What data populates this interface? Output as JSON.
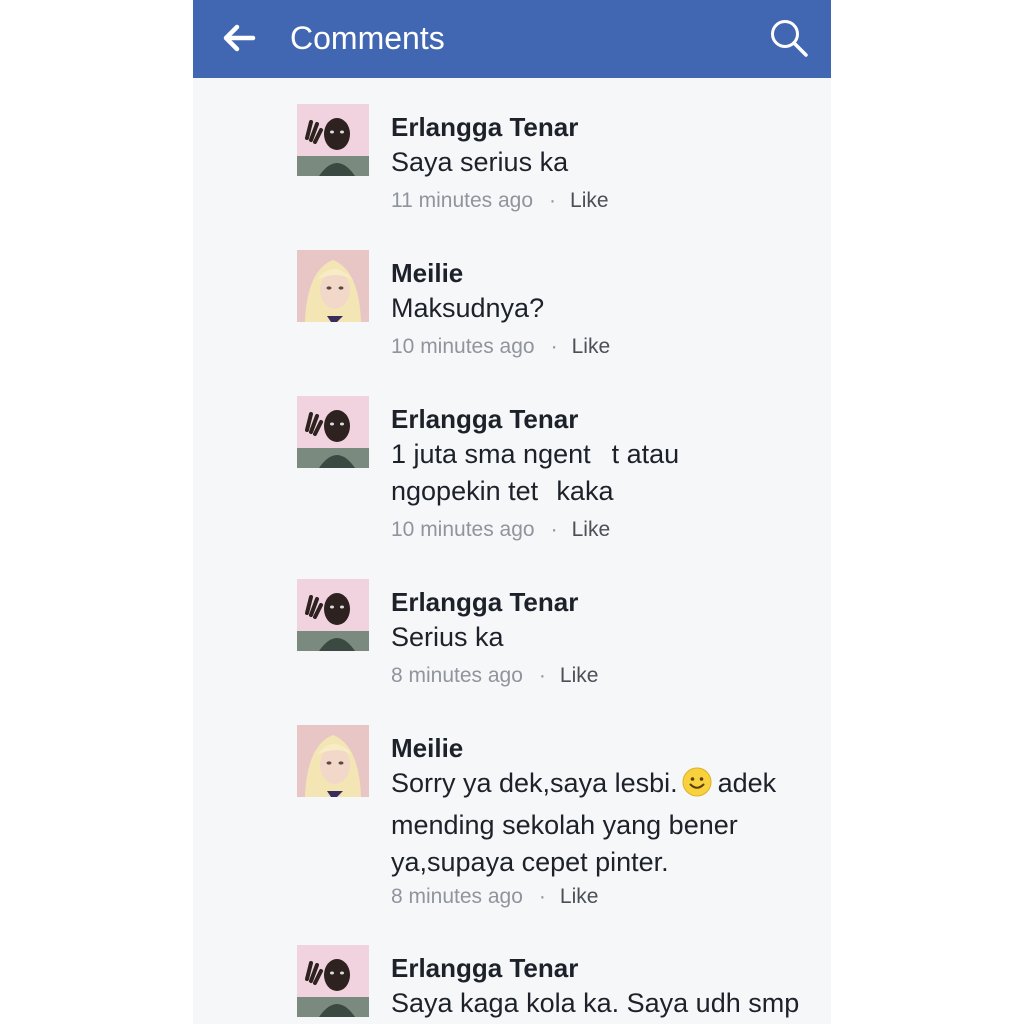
{
  "header": {
    "title": "Comments",
    "back_icon": "arrow-left-icon",
    "search_icon": "search-icon",
    "bar_color": "#4267b2"
  },
  "comments": [
    {
      "author": "Erlangga Tenar",
      "lines": [
        "Saya serius ka"
      ],
      "time": "11 minutes ago",
      "like": "Like",
      "avatar": "avatar-erlangga"
    },
    {
      "author": "Meilie",
      "lines": [
        "Maksudnya?"
      ],
      "time": "10 minutes ago",
      "like": "Like",
      "avatar": "avatar-meilie"
    },
    {
      "author": "Erlangga Tenar",
      "lines": [
        "1 juta sma ngent  t atau",
        "ngopekin tet   kaka"
      ],
      "time": "10 minutes ago",
      "like": "Like",
      "avatar": "avatar-erlangga"
    },
    {
      "author": "Erlangga Tenar",
      "lines": [
        "Serius ka"
      ],
      "time": "8 minutes ago",
      "like": "Like",
      "avatar": "avatar-erlangga"
    },
    {
      "author": "Meilie",
      "line1_before_emoji": "Sorry ya dek,saya lesbi.",
      "emoji": "smiley-face-icon",
      "line1_after_emoji": "adek",
      "lines_rest": [
        "mending sekolah yang bener",
        "ya,supaya cepet pinter."
      ],
      "time": "8 minutes ago",
      "like": "Like",
      "avatar": "avatar-meilie"
    },
    {
      "author": "Erlangga Tenar",
      "lines": [
        "Saya kaga kola ka. Saya udh smp"
      ],
      "avatar": "avatar-erlangga"
    }
  ]
}
